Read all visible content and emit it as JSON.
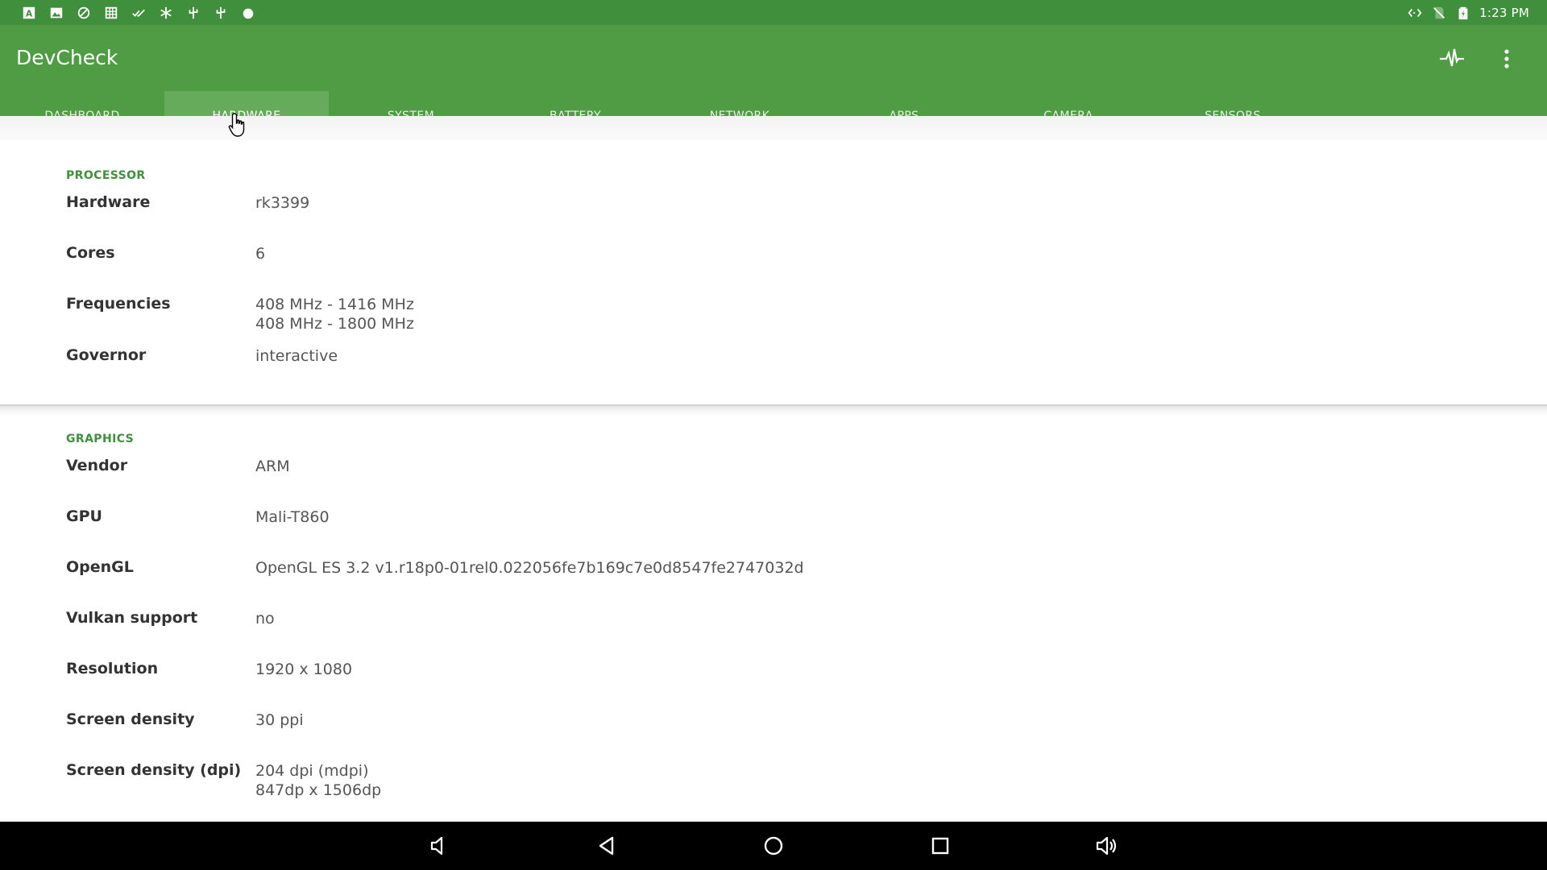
{
  "status_bar": {
    "time": "1:23 PM",
    "left_icons": [
      "text-a-icon",
      "image-icon",
      "no-entry-icon",
      "grid-icon",
      "double-check-icon",
      "snowflake-icon",
      "usb-icon",
      "usb-icon-2",
      "circle-icon"
    ],
    "right_icons": [
      "code-icon",
      "no-sim-icon",
      "battery-icon"
    ]
  },
  "app_bar": {
    "title": "DevCheck"
  },
  "tabs": [
    {
      "label": "DASHBOARD"
    },
    {
      "label": "HARDWARE"
    },
    {
      "label": "SYSTEM"
    },
    {
      "label": "BATTERY"
    },
    {
      "label": "NETWORK"
    },
    {
      "label": "APPS"
    },
    {
      "label": "CAMERA"
    },
    {
      "label": "SENSORS"
    }
  ],
  "active_tab": "HARDWARE",
  "processor": {
    "title": "PROCESSOR",
    "rows": [
      {
        "label": "Hardware",
        "values": [
          "rk3399"
        ]
      },
      {
        "label": "Cores",
        "values": [
          "6"
        ]
      },
      {
        "label": "Frequencies",
        "values": [
          "408 MHz - 1416 MHz",
          "408 MHz - 1800 MHz"
        ]
      },
      {
        "label": "Governor",
        "values": [
          "interactive"
        ]
      }
    ]
  },
  "graphics": {
    "title": "GRAPHICS",
    "rows": [
      {
        "label": "Vendor",
        "values": [
          "ARM"
        ]
      },
      {
        "label": "GPU",
        "values": [
          "Mali-T860"
        ]
      },
      {
        "label": "OpenGL",
        "values": [
          "OpenGL ES 3.2 v1.r18p0-01rel0.022056fe7b169c7e0d8547fe2747032d"
        ]
      },
      {
        "label": "Vulkan support",
        "values": [
          "no"
        ]
      },
      {
        "label": "Resolution",
        "values": [
          "1920 x 1080"
        ]
      },
      {
        "label": "Screen density",
        "values": [
          "30 ppi"
        ]
      },
      {
        "label": "Screen density (dpi)",
        "values": [
          "204 dpi (mdpi)",
          "847dp x 1506dp"
        ]
      }
    ]
  },
  "colors": {
    "status_bar": "#3f8f3c",
    "app_bar": "#4f9c44",
    "active_tab": "#66ab5b",
    "section_title": "#3f8f3c"
  }
}
